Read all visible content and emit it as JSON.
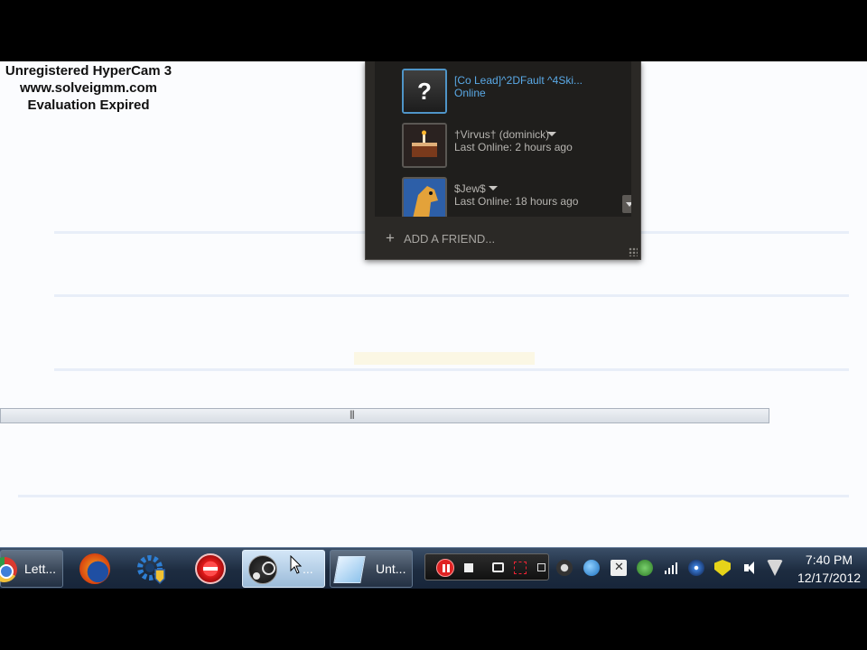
{
  "watermark": {
    "line1": "Unregistered HyperCam 3",
    "line2": "www.solveigmm.com",
    "line3": "Evaluation Expired"
  },
  "friends_panel": {
    "friends": [
      {
        "name": "[Co Lead]^2DFault ^4Ski...",
        "status": "Online",
        "avatar": "question-mark-avatar",
        "online": true
      },
      {
        "name": "†Virvus† (dominick)",
        "status": "Last Online: 2 hours ago",
        "avatar": "cake-avatar",
        "online": false
      },
      {
        "name": "$Jew$",
        "status": "Last Online: 18 hours ago",
        "avatar": "horse-avatar",
        "online": false
      }
    ],
    "add_friend_label": "ADD A FRIEND...",
    "add_friend_icon": "plus-icon"
  },
  "taskbar": {
    "chrome_label": "Lett...",
    "steam_label": "...",
    "paint_label": "Unt...",
    "hypercam_controls": [
      "pause",
      "stop",
      "screenshot",
      "region",
      "minimize"
    ],
    "tray_icons": [
      "steam-tray-icon",
      "globe-tray-icon",
      "x-tray-icon",
      "shield-tray-icon",
      "signal-tray-icon",
      "disc-tray-icon",
      "warning-shield-icon",
      "volume-icon",
      "v-tray-icon"
    ]
  },
  "clock": {
    "time": "7:40 PM",
    "date": "12/17/2012"
  },
  "colors": {
    "online_blue": "#5aa9e6",
    "panel_bg": "#2b2926",
    "taskbar_bg": "#1d2c40"
  }
}
